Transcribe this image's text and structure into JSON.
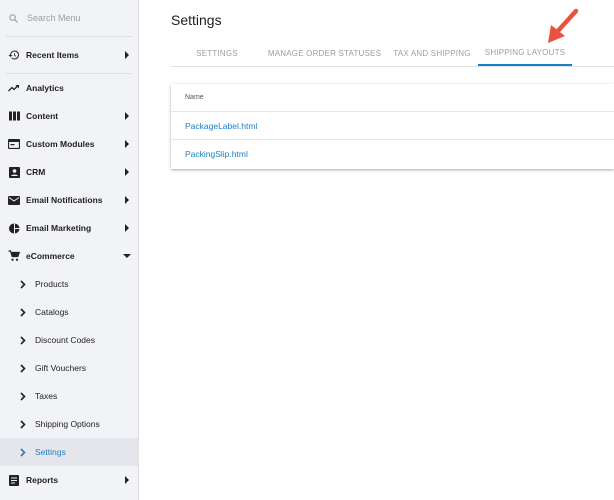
{
  "sidebar": {
    "search_placeholder": "Search Menu",
    "recent_items": "Recent Items",
    "items": [
      {
        "label": "Analytics",
        "icon": "trending-up-icon",
        "has_arrow": false
      },
      {
        "label": "Content",
        "icon": "columns-icon",
        "has_arrow": true
      },
      {
        "label": "Custom Modules",
        "icon": "module-icon",
        "has_arrow": true
      },
      {
        "label": "CRM",
        "icon": "contact-icon",
        "has_arrow": true
      },
      {
        "label": "Email Notifications",
        "icon": "mail-icon",
        "has_arrow": true
      },
      {
        "label": "Email Marketing",
        "icon": "pie-chart-icon",
        "has_arrow": true
      },
      {
        "label": "eCommerce",
        "icon": "cart-icon",
        "has_arrow": true,
        "expanded": true
      }
    ],
    "ecommerce_children": [
      {
        "label": "Products"
      },
      {
        "label": "Catalogs"
      },
      {
        "label": "Discount Codes"
      },
      {
        "label": "Gift Vouchers"
      },
      {
        "label": "Taxes"
      },
      {
        "label": "Shipping Options"
      },
      {
        "label": "Settings",
        "active": true
      }
    ],
    "reports": "Reports"
  },
  "main": {
    "title": "Settings",
    "tabs": [
      {
        "label": "SETTINGS"
      },
      {
        "label": "MANAGE ORDER STATUSES"
      },
      {
        "label": "TAX AND SHIPPING"
      },
      {
        "label": "SHIPPING LAYOUTS",
        "active": true
      }
    ],
    "table": {
      "header": "Name",
      "rows": [
        "PackageLabel.html",
        "PackingSlip.html"
      ]
    }
  },
  "colors": {
    "accent": "#1a82c4",
    "annotation_arrow": "#e8533f",
    "sidebar_bg": "#f2f3f6"
  }
}
